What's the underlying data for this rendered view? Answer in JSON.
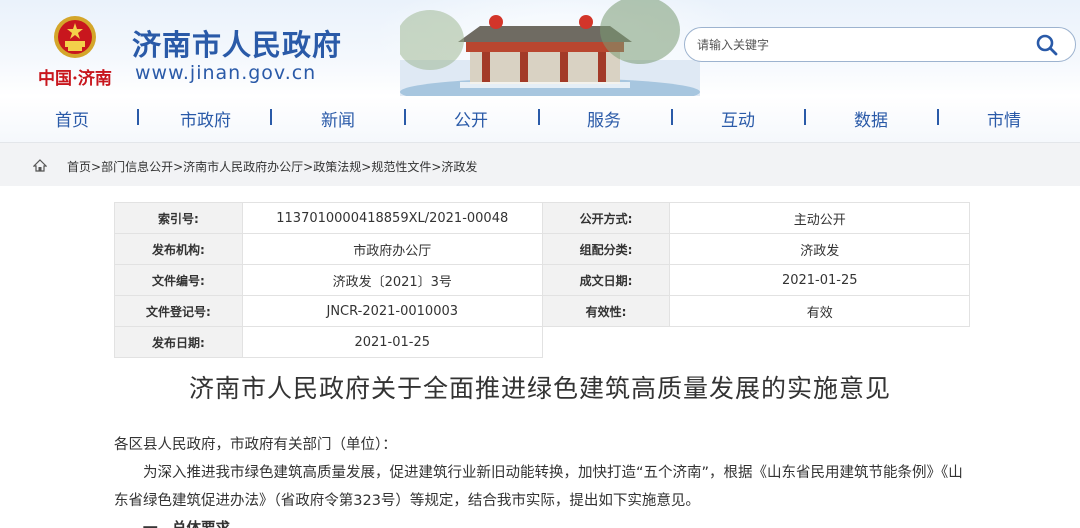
{
  "header": {
    "site_title": "济南市人民政府",
    "site_url": "www.jinan.gov.cn",
    "brand_cn": "中国·济南",
    "search_placeholder": "请输入关键字"
  },
  "nav": {
    "items": [
      "首页",
      "市政府",
      "新闻",
      "公开",
      "服务",
      "互动",
      "数据",
      "市情"
    ]
  },
  "breadcrumb": {
    "items": [
      "首页",
      "部门信息公开",
      "济南市人民政府办公厅",
      "政策法规",
      "规范性文件",
      "济政发"
    ],
    "separator": ">"
  },
  "info": {
    "rows": [
      [
        {
          "k": "索引号:",
          "v": "11370100004188 59XL/2021-00048"
        },
        {
          "k": "公开方式:",
          "v": "主动公开"
        }
      ],
      [
        {
          "k": "发布机构:",
          "v": "市政府办公厅"
        },
        {
          "k": "组配分类:",
          "v": "济政发"
        }
      ],
      [
        {
          "k": "文件编号:",
          "v": "济政发〔2021〕3号"
        },
        {
          "k": "成文日期:",
          "v": "2021-01-25"
        }
      ],
      [
        {
          "k": "文件登记号:",
          "v": "JNCR-2021-0010003"
        },
        {
          "k": "有效性:",
          "v": "有效"
        }
      ],
      [
        {
          "k": "发布日期:",
          "v": "2021-01-25"
        }
      ]
    ]
  },
  "document": {
    "title": "济南市人民政府关于全面推进绿色建筑高质量发展的实施意见",
    "salutation": "各区县人民政府，市政府有关部门（单位）：",
    "para1_line1": "为深入推进我市绿色建筑高质量发展，促进建筑行业新旧动能转换，加快打造“五个济南”，根据《山东省民用建筑节能条例》《山",
    "para1_line2": "东省绿色建筑促进办法》（省政府令第323号）等规定，结合我市实际，提出如下实施意见。",
    "section1": "一、总体要求"
  },
  "colors": {
    "brand_blue": "#2a5aa8",
    "brand_red": "#c8161d",
    "table_key_bg": "#f2f2f2"
  }
}
